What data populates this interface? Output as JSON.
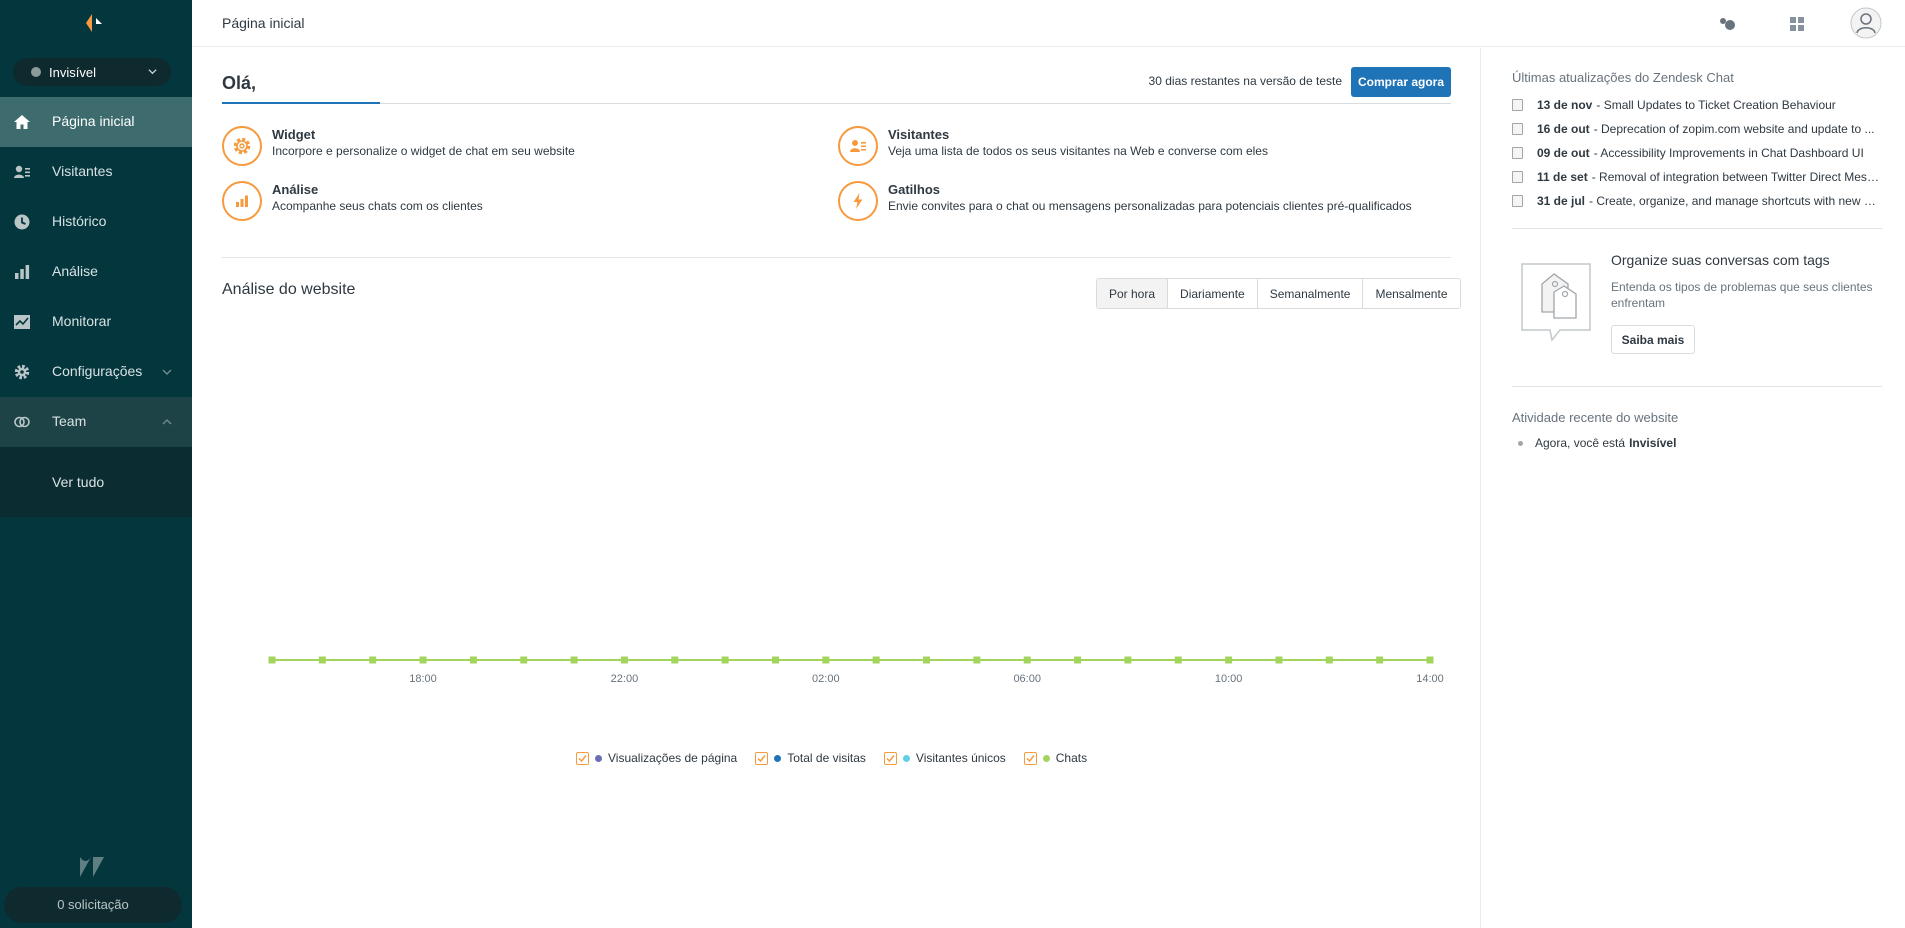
{
  "sidebar": {
    "status": {
      "label": "Invisível",
      "dot_color": "#8c9a9c"
    },
    "nav": [
      {
        "label": "Página inicial",
        "icon": "home-icon",
        "active": true
      },
      {
        "label": "Visitantes",
        "icon": "visitors-icon"
      },
      {
        "label": "Histórico",
        "icon": "history-icon"
      },
      {
        "label": "Análise",
        "icon": "analytics-icon"
      },
      {
        "label": "Monitorar",
        "icon": "monitor-icon"
      },
      {
        "label": "Configurações",
        "icon": "settings-icon"
      },
      {
        "label": "Team",
        "icon": "team-icon"
      }
    ],
    "team_sub": "Ver tudo",
    "requests": "0 solicitação"
  },
  "header": {
    "title": "Página inicial",
    "icons": [
      "status-toggle-icon",
      "apps-grid-icon",
      "profile-icon"
    ]
  },
  "main": {
    "greeting": "Olá,",
    "trial_text": "30 dias restantes na versão de teste",
    "buy_label": "Comprar agora",
    "features": [
      {
        "title": "Widget",
        "desc": "Incorpore e personalize o widget de chat em seu website",
        "icon": "gear-icon"
      },
      {
        "title": "Visitantes",
        "desc": "Veja uma lista de todos os seus visitantes na Web e converse com eles",
        "icon": "visitors-card-icon"
      },
      {
        "title": "Análise",
        "desc": "Acompanhe seus chats com os clientes",
        "icon": "bar-chart-icon"
      },
      {
        "title": "Gatilhos",
        "desc": "Envie convites para o chat ou mensagens personalizadas para potenciais clientes pré-qualificados",
        "icon": "lightning-icon"
      }
    ],
    "analysis_title": "Análise do website",
    "periods": [
      "Por hora",
      "Diariamente",
      "Semanalmente",
      "Mensalmente"
    ],
    "active_period": "Por hora",
    "legend": [
      {
        "label": "Visualizações de página",
        "color": "#6b6fb3"
      },
      {
        "label": "Total de visitas",
        "color": "#1f73b7"
      },
      {
        "label": "Visitantes únicos",
        "color": "#62d0e4"
      },
      {
        "label": "Chats",
        "color": "#a3d55e"
      }
    ]
  },
  "chart_data": {
    "type": "line",
    "x": [
      "",
      "",
      "",
      "18:00",
      "",
      "",
      "",
      "22:00",
      "",
      "",
      "",
      "02:00",
      "",
      "",
      "",
      "06:00",
      "",
      "",
      "",
      "10:00",
      "",
      "",
      "",
      "14:00"
    ],
    "tick_labels": [
      "18:00",
      "22:00",
      "02:00",
      "06:00",
      "10:00",
      "14:00"
    ],
    "series": [
      {
        "name": "Chats",
        "values": [
          0,
          0,
          0,
          0,
          0,
          0,
          0,
          0,
          0,
          0,
          0,
          0,
          0,
          0,
          0,
          0,
          0,
          0,
          0,
          0,
          0,
          0,
          0,
          0
        ],
        "color": "#a3d55e"
      }
    ],
    "legend": "bottom",
    "grid": false
  },
  "right": {
    "updates_heading": "Últimas atualizações do Zendesk Chat",
    "updates": [
      {
        "date": "13 de nov",
        "text": "- Small Updates to Ticket Creation Behaviour"
      },
      {
        "date": "16 de out",
        "text": "- Deprecation of zopim.com website and update to ..."
      },
      {
        "date": "09 de out",
        "text": "- Accessibility Improvements in Chat Dashboard UI"
      },
      {
        "date": "11 de set",
        "text": "- Removal of integration between Twitter Direct Mess..."
      },
      {
        "date": "31 de jul",
        "text": "- Create, organize, and manage shortcuts with new en..."
      }
    ],
    "tags_title": "Organize suas conversas com tags",
    "tags_desc": "Entenda os tipos de problemas que seus clientes enfrentam",
    "learn_more": "Saiba mais",
    "activity_heading": "Atividade recente do website",
    "activity_prefix": "Agora, você está",
    "activity_status": "Invisível"
  },
  "colors": {
    "sidebar_bg": "#03363d",
    "active_nav": "#3d6b6e",
    "accent": "#1f73b7",
    "orange": "#f79a3e"
  }
}
